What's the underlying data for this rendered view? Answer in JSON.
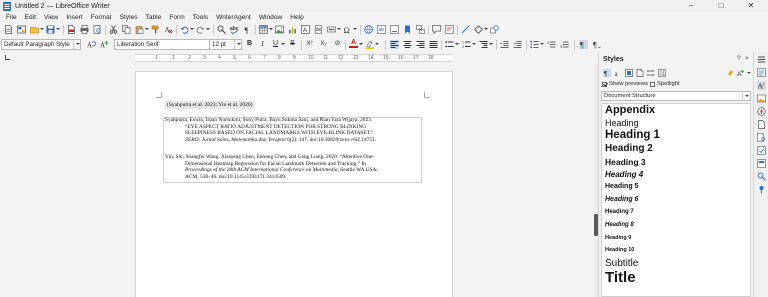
{
  "window": {
    "title": "Untitled 2 — LibreOffice Writer",
    "controls": {
      "minimize": "–",
      "maximize": "□",
      "close": "✕"
    }
  },
  "menu": [
    "File",
    "Edit",
    "View",
    "Insert",
    "Format",
    "Styles",
    "Table",
    "Form",
    "Tools",
    "WriterAgent",
    "Window",
    "Help"
  ],
  "toolbar_formatting": {
    "paragraph_style": "Default Paragraph Style",
    "font_name": "Liberation Serif",
    "font_size": "12 pt",
    "bold": "B",
    "italic": "I",
    "underline": "U",
    "strikethrough": "S",
    "superscript": "X²",
    "subscript": "X₂",
    "font_color": "A"
  },
  "ruler": {
    "labels": [
      "1",
      "1",
      "2",
      "3",
      "4",
      "5",
      "6",
      "7",
      "8",
      "9",
      "10",
      "11",
      "12",
      "13",
      "14",
      "15",
      "16",
      "17",
      "18"
    ]
  },
  "document": {
    "citation": "(Syahputra et al. 2023; Yin et al. 2020)",
    "bibliography": [
      {
        "line1": "Syahputra, Eswin, Irpan Nursukmi, Sony Putra, Bayu Sukma Sani, and Rian Fara Wijaya. 2023.",
        "line2": "“EYE ASPECT RATIO ADJUSTMENT DETECTION FOR STRONG BLINKING",
        "line3": "SLEEPINESS BASED ON FACIAL LANDMARKS WITH EYE-BLINK DATASET.”",
        "line4_italic": "ZERO: Jurnal Sains, Matematika dan Terapan",
        "line4_rest": " 6(2): 147. doi:10.30829/zero.v6i2.14751."
      },
      {
        "line1": "Yin, Shi, Shangfei Wang, Xiaoping Chen, Enhong Chen, and Cong Liang. 2020. “Attentive One-",
        "line2": "Dimensional Heatmap Regression for Facial Landmark Detection and Tracking.” In",
        "line3_italic": "Proceedings of the 28th ACM International Conference on Multimedia",
        "line3_rest": ", Seattle WA USA:",
        "line4": "ACM, 538–46. doi:10.1145/3394171.3413509."
      }
    ]
  },
  "sidebar": {
    "title": "Styles",
    "help": "?",
    "close": "×",
    "menu": "≡",
    "show_previews_label": "Show previews",
    "show_previews_checked": true,
    "spotlight_label": "Spotlight",
    "spotlight_checked": false,
    "filter": "Document Structure",
    "styles": [
      {
        "name": "Appendix",
        "size": 11,
        "weight": "bold",
        "italic": false
      },
      {
        "name": "Heading",
        "size": 9,
        "weight": "normal",
        "italic": false
      },
      {
        "name": "Heading 1",
        "size": 11.5,
        "weight": "bold",
        "italic": false
      },
      {
        "name": "Heading 2",
        "size": 10,
        "weight": "bold",
        "italic": false
      },
      {
        "name": "Heading 3",
        "size": 8.5,
        "weight": "bold",
        "italic": false
      },
      {
        "name": "Heading 4",
        "size": 8,
        "weight": "bold",
        "italic": true
      },
      {
        "name": "Heading 5",
        "size": 7,
        "weight": "bold",
        "italic": false
      },
      {
        "name": "Heading 6",
        "size": 7,
        "weight": "bold",
        "italic": true
      },
      {
        "name": "Heading 7",
        "size": 6,
        "weight": "bold",
        "italic": false
      },
      {
        "name": "Heading 8",
        "size": 6,
        "weight": "bold",
        "italic": true
      },
      {
        "name": "Heading 9",
        "size": 5.5,
        "weight": "bold",
        "italic": false
      },
      {
        "name": "Heading 10",
        "size": 5.5,
        "weight": "bold",
        "italic": false
      },
      {
        "name": "Subtitle",
        "size": 10,
        "weight": "normal",
        "italic": false
      },
      {
        "name": "Title",
        "size": 15,
        "weight": "bold",
        "italic": false
      }
    ]
  },
  "colors": {
    "accent": "#2a6dc4",
    "highlight_yellow": "#f5c400",
    "font_red": "#c9211e",
    "active_panel": "#c9d9ee"
  }
}
